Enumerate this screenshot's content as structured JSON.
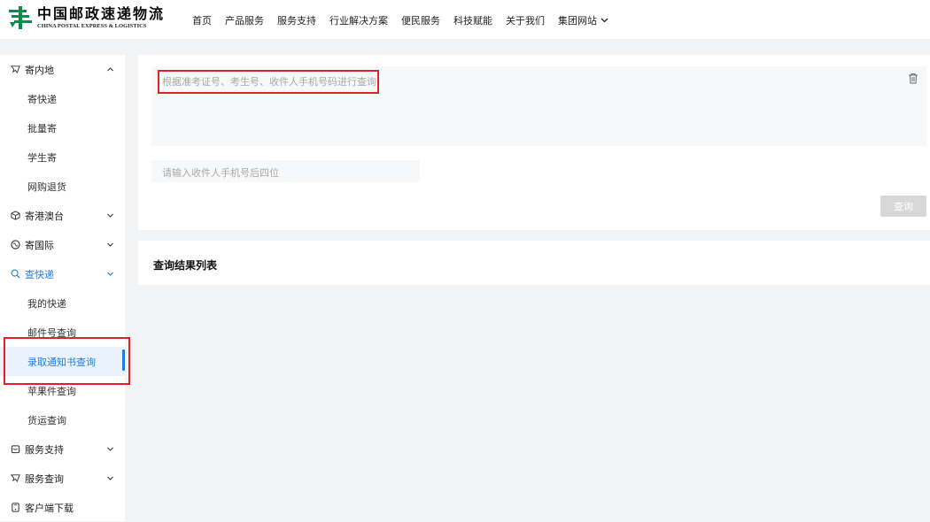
{
  "brand": {
    "name_cn": "中国邮政速递物流",
    "name_en": "CHINA POSTAL EXPRESS & LOGISTICS",
    "color": "#00904b"
  },
  "nav": {
    "items": [
      "首页",
      "产品服务",
      "服务支持",
      "行业解决方案",
      "便民服务",
      "科技赋能",
      "关于我们",
      "集团网站"
    ]
  },
  "sidebar": {
    "groups": [
      {
        "label": "寄内地",
        "icon": "send-icon",
        "expanded": true
      },
      {
        "label": "寄港澳台",
        "icon": "box-icon",
        "expanded": false
      },
      {
        "label": "寄国际",
        "icon": "globe-icon",
        "expanded": false
      },
      {
        "label": "查快递",
        "icon": "search-icon",
        "expanded": true
      },
      {
        "label": "服务支持",
        "icon": "service-icon",
        "expanded": false
      },
      {
        "label": "服务查询",
        "icon": "send-icon",
        "expanded": false
      },
      {
        "label": "客户端下载",
        "icon": "phone-icon",
        "expanded": false
      }
    ],
    "sub_inland": [
      "寄快递",
      "批量寄",
      "学生寄",
      "网购退货"
    ],
    "sub_query": [
      "我的快递",
      "邮件号查询",
      "录取通知书查询",
      "苹果件查询",
      "货运查询"
    ],
    "selected": "录取通知书查询",
    "accent_color": "#1f7ddf"
  },
  "query": {
    "textarea_placeholder": "根据准考证号、考生号、收件人手机号码进行查询",
    "phone_placeholder": "请输入收件人手机号后四位",
    "button_label": "查询"
  },
  "results": {
    "title": "查询结果列表"
  },
  "annotation_color": "#e0202a"
}
